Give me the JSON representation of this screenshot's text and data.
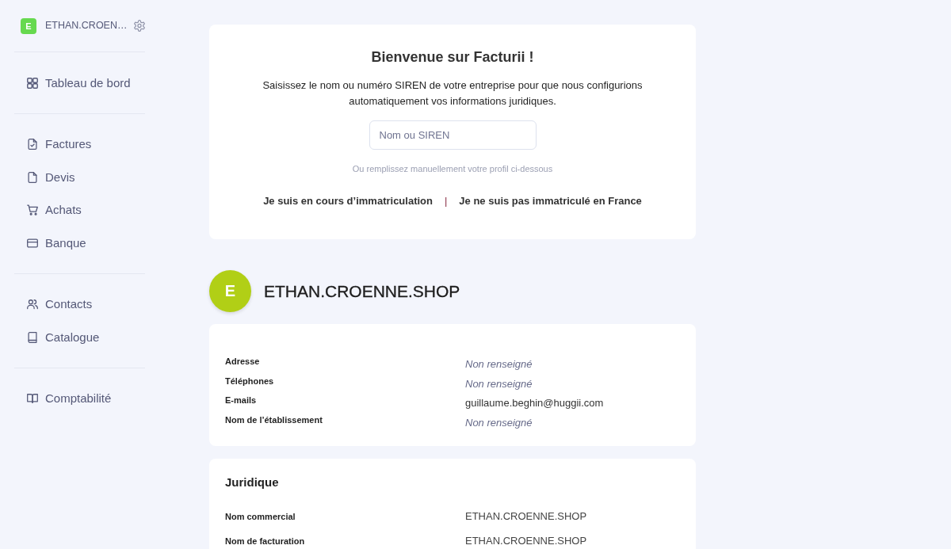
{
  "sidebar": {
    "account": {
      "avatar_letter": "E",
      "name": "ETHAN.CROEN…"
    },
    "groups": [
      {
        "items": [
          {
            "label": "Tableau de bord",
            "selected": false
          }
        ]
      },
      {
        "items": [
          {
            "label": "Factures",
            "selected": false
          },
          {
            "label": "Devis",
            "selected": false
          },
          {
            "label": "Achats",
            "selected": false
          },
          {
            "label": "Banque",
            "selected": false
          }
        ]
      },
      {
        "items": [
          {
            "label": "Contacts",
            "selected": false
          },
          {
            "label": "Catalogue",
            "selected": false
          }
        ]
      },
      {
        "items": [
          {
            "label": "Comptabilité",
            "selected": false
          }
        ]
      }
    ]
  },
  "welcome": {
    "title": "Bienvenue sur Facturii !",
    "text": "Saisissez le nom ou numéro SIREN de votre entreprise pour que nous configurions automatiquement vos informations juridiques.",
    "search": {
      "placeholder": "Nom ou SIREN"
    },
    "hint": "Ou remplissez manuellement votre profil ci-dessous",
    "links": [
      "Je suis en cours d’immatriculation",
      "Je ne suis pas immatriculé en France"
    ],
    "separator": "|"
  },
  "company": {
    "avatar_letter": "E",
    "name": "ETHAN.CROENNE.SHOP"
  },
  "contact_card": {
    "rows": [
      {
        "label": "Adresse",
        "value": "Non renseigné",
        "missing": true
      },
      {
        "label": "Téléphones",
        "value": "Non renseigné",
        "missing": true
      },
      {
        "label": "E-mails",
        "value": "guillaume.beghin@huggii.com",
        "missing": false
      },
      {
        "label": "Nom de l’établissement",
        "value": "Non renseigné",
        "missing": true
      }
    ]
  },
  "legal_card": {
    "title": "Juridique",
    "rows": [
      {
        "label": "Nom commercial",
        "value": "ETHAN.CROENNE.SHOP",
        "missing": false
      },
      {
        "label": "Nom de facturation",
        "value": "ETHAN.CROENNE.SHOP",
        "missing": false
      }
    ]
  }
}
